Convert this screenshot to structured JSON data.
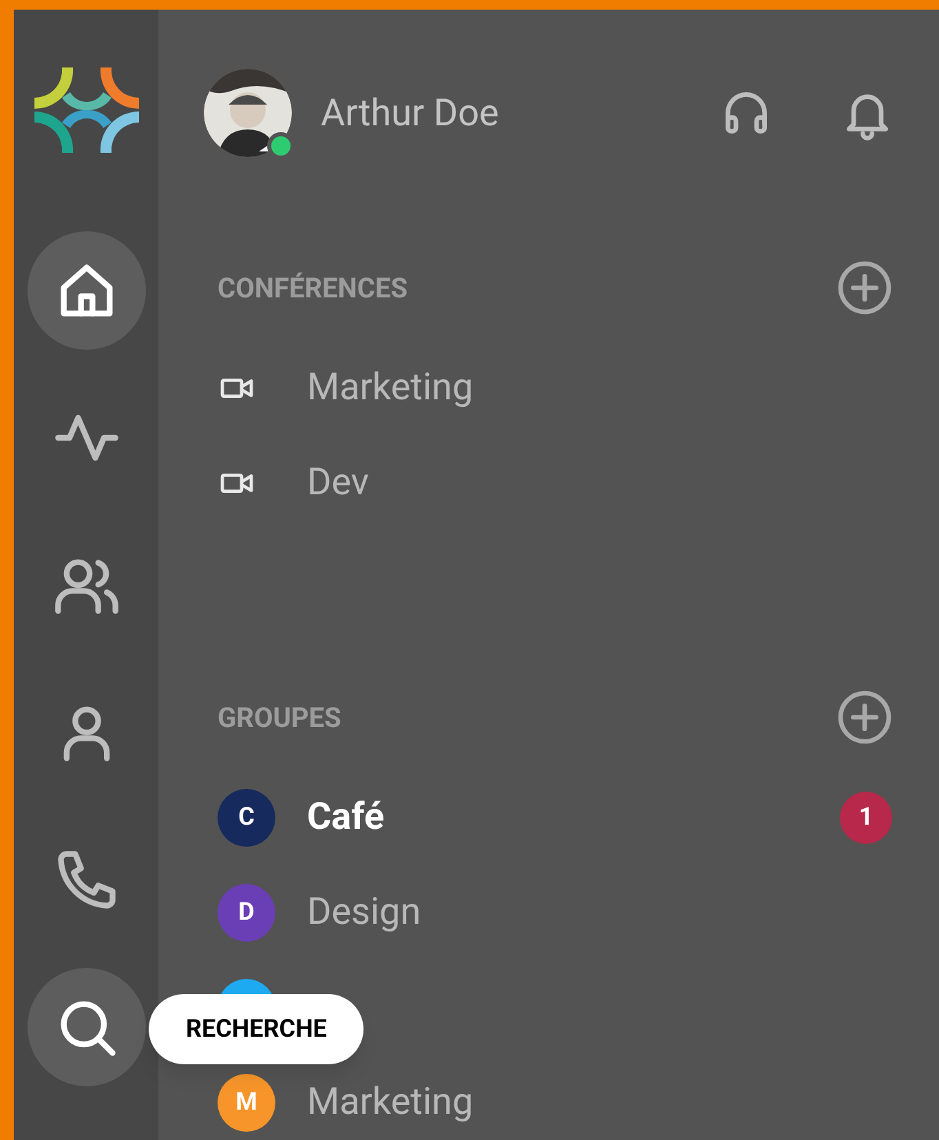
{
  "user": {
    "name": "Arthur Doe",
    "online": true
  },
  "rail": [
    {
      "kind": "home",
      "highlighted": true
    },
    {
      "kind": "activity",
      "highlighted": false
    },
    {
      "kind": "people",
      "highlighted": false
    },
    {
      "kind": "person",
      "highlighted": false
    },
    {
      "kind": "phone",
      "highlighted": false
    },
    {
      "kind": "search",
      "highlighted": true
    }
  ],
  "conferences": {
    "title": "CONFÉRENCES",
    "items": [
      {
        "name": "Marketing"
      },
      {
        "name": "Dev"
      }
    ]
  },
  "groups": {
    "title": "GROUPES",
    "items": [
      {
        "letter": "C",
        "name": "Café",
        "color": "#172a5e",
        "unread": true,
        "badge": "1"
      },
      {
        "letter": "D",
        "name": "Design",
        "color": "#6a3fb5",
        "unread": false
      },
      {
        "color": "#1eaaf1"
      },
      {
        "letter": "M",
        "name": "Marketing",
        "color": "#f7952a",
        "unread": false
      }
    ]
  },
  "tooltip": "RECHERCHE"
}
